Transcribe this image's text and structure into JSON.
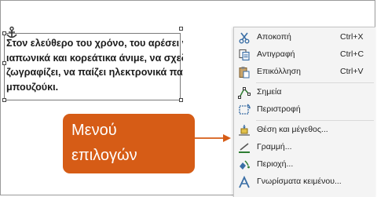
{
  "document": {
    "lines": [
      "Στον ελεύθερο του χρόνο, του αρέσει να",
      "ιαπωνικά και κορεάτικα άνιμε, να σχεδιά",
      "ζωγραφίζει, να παίζει ηλεκτρονικά παιχν",
      "μπουζούκι."
    ]
  },
  "context_menu": {
    "items": [
      {
        "label": "Αποκοπή",
        "shortcut": "Ctrl+X",
        "icon": "scissors-icon"
      },
      {
        "label": "Αντιγραφή",
        "shortcut": "Ctrl+C",
        "icon": "copy-icon"
      },
      {
        "label": "Επικόλληση",
        "shortcut": "Ctrl+V",
        "icon": "paste-icon"
      },
      {
        "label": "Σημεία",
        "shortcut": "",
        "icon": "edit-points-icon"
      },
      {
        "label": "Περιστροφή",
        "shortcut": "",
        "icon": "rotate-icon"
      },
      {
        "label": "Θέση και μέγεθος...",
        "shortcut": "",
        "icon": "position-size-icon"
      },
      {
        "label": "Γραμμή...",
        "shortcut": "",
        "icon": "line-icon"
      },
      {
        "label": "Περιοχή...",
        "shortcut": "",
        "icon": "area-fill-icon"
      },
      {
        "label": "Γνωρίσματα κειμένου...",
        "shortcut": "",
        "icon": "text-attributes-icon"
      }
    ]
  },
  "callout": {
    "line1": "Μενού",
    "line2": "επιλογών"
  },
  "colors": {
    "callout_bg": "#d65c16",
    "arrow": "#d65c16",
    "menu_bg": "#f4f4f4"
  }
}
